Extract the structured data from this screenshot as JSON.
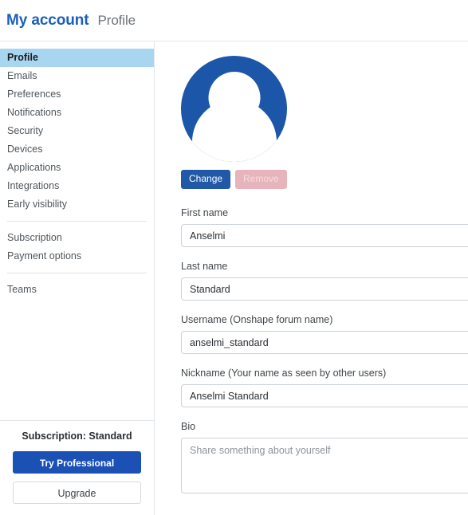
{
  "header": {
    "title": "My account",
    "subtitle": "Profile"
  },
  "sidebar": {
    "items": [
      {
        "label": "Profile",
        "active": true
      },
      {
        "label": "Emails",
        "active": false
      },
      {
        "label": "Preferences",
        "active": false
      },
      {
        "label": "Notifications",
        "active": false
      },
      {
        "label": "Security",
        "active": false
      },
      {
        "label": "Devices",
        "active": false
      },
      {
        "label": "Applications",
        "active": false
      },
      {
        "label": "Integrations",
        "active": false
      },
      {
        "label": "Early visibility",
        "active": false
      }
    ],
    "group2": [
      {
        "label": "Subscription"
      },
      {
        "label": "Payment options"
      }
    ],
    "group3": [
      {
        "label": "Teams"
      }
    ],
    "footer": {
      "subscription_label": "Subscription: Standard",
      "try_button": "Try Professional",
      "upgrade_button": "Upgrade"
    }
  },
  "main": {
    "avatar_alt": "user-avatar",
    "change_button": "Change",
    "remove_button": "Remove",
    "fields": [
      {
        "label": "First name",
        "value": "Anselmi",
        "placeholder": ""
      },
      {
        "label": "Last name",
        "value": "Standard",
        "placeholder": ""
      },
      {
        "label": "Username (Onshape forum name)",
        "value": "anselmi_standard",
        "placeholder": ""
      },
      {
        "label": "Nickname (Your name as seen by other users)",
        "value": "Anselmi Standard",
        "placeholder": ""
      }
    ],
    "bio": {
      "label": "Bio",
      "value": "",
      "placeholder": "Share something about yourself"
    }
  },
  "colors": {
    "brand_blue": "#1b5fbe",
    "active_nav": "#a8d6f0",
    "avatar_blue": "#1b56a8",
    "primary_button": "#1b50b4",
    "remove_disabled": "#e8b4bb"
  }
}
